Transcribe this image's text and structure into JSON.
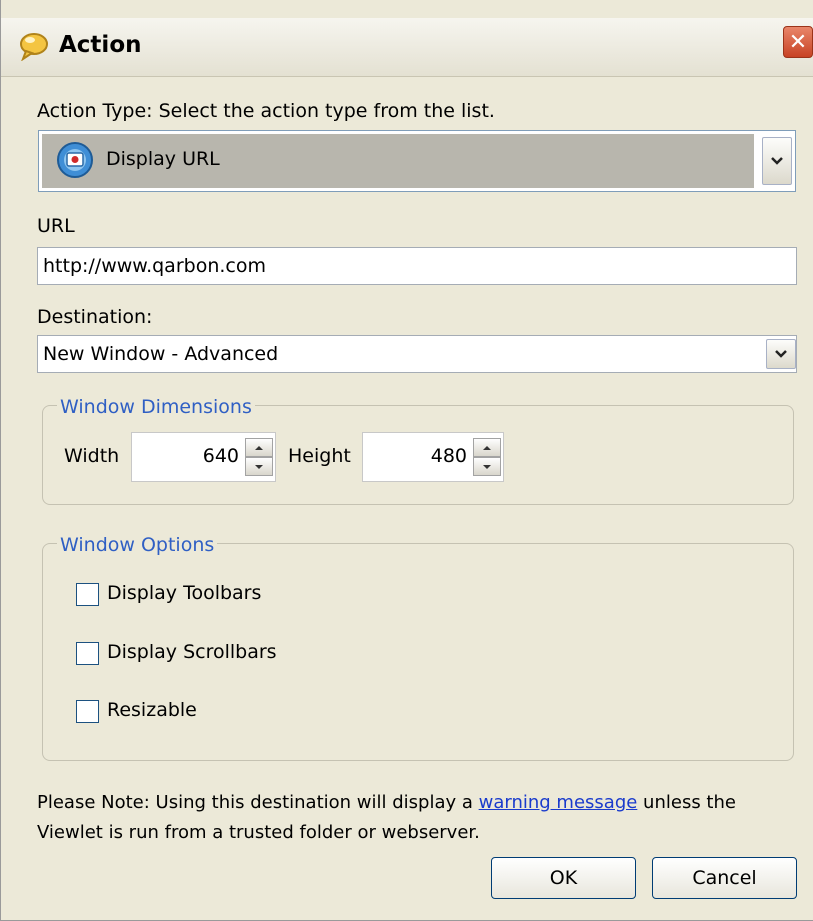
{
  "window": {
    "title": "Action",
    "close_glyph": "✕"
  },
  "action_type": {
    "label": "Action Type: Select the action type from the list.",
    "selected": "Display URL",
    "icon": "display-url-icon"
  },
  "url": {
    "label": "URL",
    "value": "http://www.qarbon.com"
  },
  "destination": {
    "label": "Destination:",
    "selected": "New Window - Advanced"
  },
  "window_dimensions": {
    "title": "Window Dimensions",
    "width_label": "Width",
    "width_value": "640",
    "height_label": "Height",
    "height_value": "480"
  },
  "window_options": {
    "title": "Window Options",
    "items": [
      {
        "label": "Display Toolbars",
        "checked": false
      },
      {
        "label": "Display Scrollbars",
        "checked": false
      },
      {
        "label": "Resizable",
        "checked": false
      }
    ]
  },
  "note": {
    "prefix": "Please Note: Using this destination will display a ",
    "link": "warning message",
    "suffix_line1": " unless the",
    "line2": "Viewlet is run from a trusted folder or webserver."
  },
  "buttons": {
    "ok": "OK",
    "cancel": "Cancel"
  },
  "colors": {
    "dialog_bg": "#ece9d8",
    "group_title": "#2f5fc4",
    "link": "#1a3bcc",
    "close": "#c74224"
  }
}
